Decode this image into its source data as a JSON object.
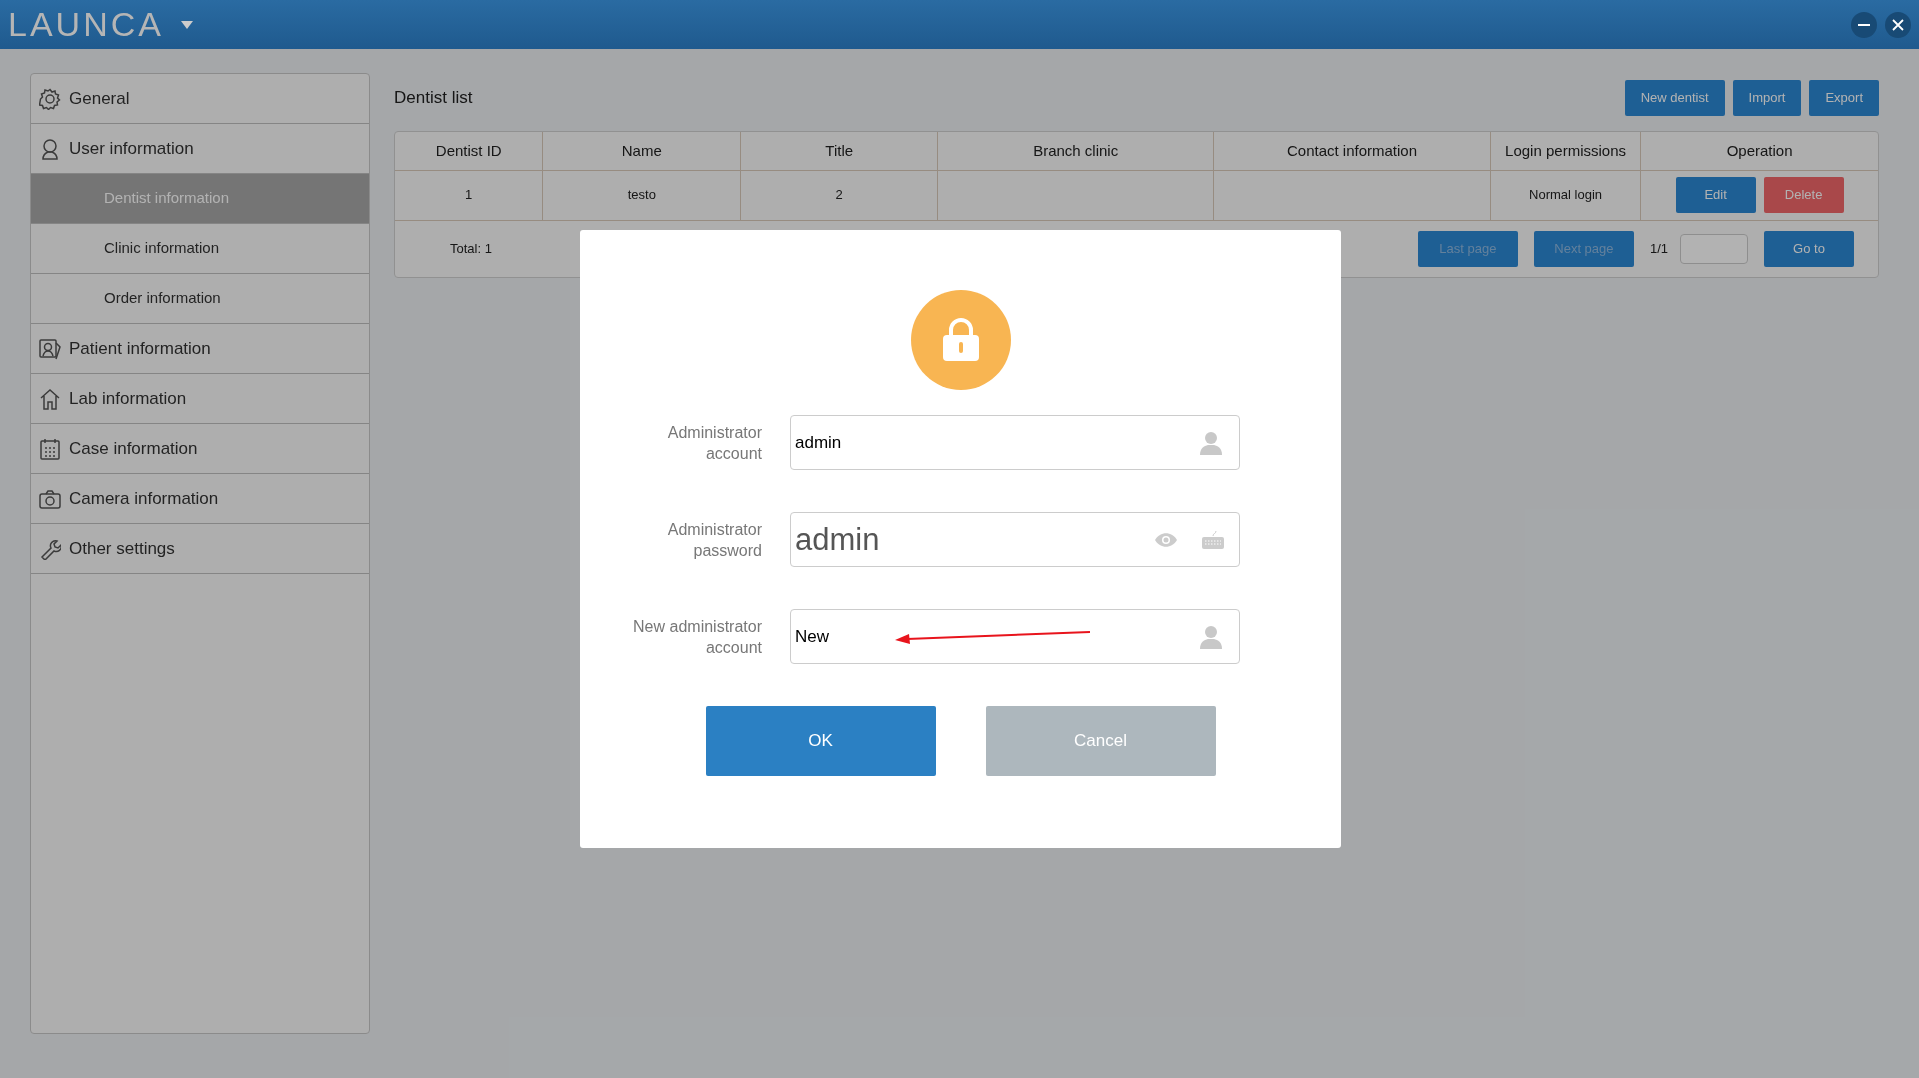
{
  "app": {
    "logo": "LAUNCA"
  },
  "sidebar": {
    "items": [
      {
        "label": "General",
        "selected": false
      },
      {
        "label": "User information",
        "selected": false,
        "children": [
          {
            "label": "Dentist information",
            "selected": true
          },
          {
            "label": "Clinic information",
            "selected": false
          },
          {
            "label": "Order information",
            "selected": false
          }
        ]
      },
      {
        "label": "Patient information",
        "selected": false
      },
      {
        "label": "Lab information",
        "selected": false
      },
      {
        "label": "Case information",
        "selected": false
      },
      {
        "label": "Camera information",
        "selected": false
      },
      {
        "label": "Other settings",
        "selected": false
      }
    ]
  },
  "page": {
    "title": "Dentist list",
    "actions": [
      "New dentist",
      "Import",
      "Export"
    ]
  },
  "table": {
    "columns": [
      "Dentist ID",
      "Name",
      "Title",
      "Branch clinic",
      "Contact information",
      "Login permissions",
      "Operation"
    ],
    "rows": [
      {
        "dentist_id": "1",
        "name": "testo",
        "title": "2",
        "login_permissions": "Normal login",
        "actions": [
          {
            "label": "Edit",
            "kind": "edit"
          },
          {
            "label": "Delete",
            "kind": "delete"
          }
        ]
      }
    ]
  },
  "pagination": {
    "total": "Total: 1",
    "buttons": [
      {
        "label": "Last page",
        "disabled": true
      },
      {
        "label": "Next page",
        "disabled": true
      }
    ],
    "page": "1/1",
    "goto": "Go to"
  },
  "dialog": {
    "fields": [
      {
        "label": "Administrator account",
        "value": "admin",
        "kind": "account"
      },
      {
        "label": "Administrator password",
        "value": "admin",
        "kind": "password"
      },
      {
        "label": "New administrator account",
        "value": "New",
        "kind": "account",
        "annotated": true
      }
    ],
    "buttons": [
      {
        "label": "OK",
        "kind": "primary"
      },
      {
        "label": "Cancel",
        "kind": "secondary"
      }
    ]
  }
}
